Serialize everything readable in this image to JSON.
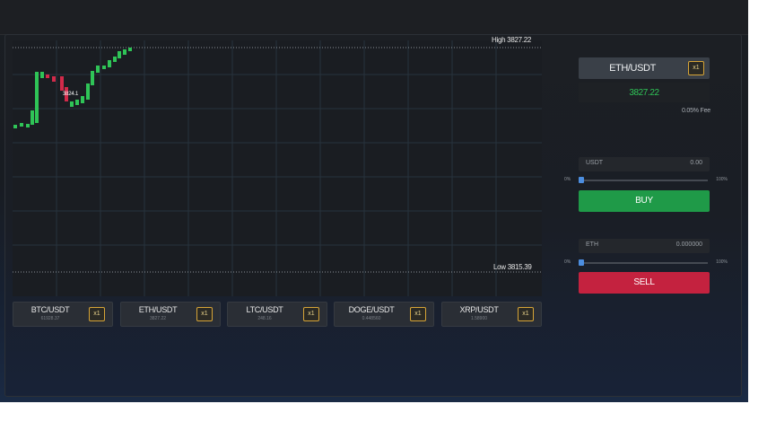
{
  "chart": {
    "high_label": "High 3827.22",
    "low_label": "Low 3815.39",
    "price_tag": "3824.1",
    "colors": {
      "up": "#2fc457",
      "down": "#d22a4a",
      "grid": "#27323d"
    }
  },
  "markets": [
    {
      "pair": "BTC/USDT",
      "price": "61928.37",
      "multiplier": "x1"
    },
    {
      "pair": "ETH/USDT",
      "price": "3827.22",
      "multiplier": "x1"
    },
    {
      "pair": "LTC/USDT",
      "price": "248.16",
      "multiplier": "x1"
    },
    {
      "pair": "DOGE/USDT",
      "price": "0.448560",
      "multiplier": "x1"
    },
    {
      "pair": "XRP/USDT",
      "price": "1.58900",
      "multiplier": "x1"
    }
  ],
  "trade": {
    "pair": "ETH/USDT",
    "multiplier": "x1",
    "price": "3827.22",
    "fee": "0.05% Fee",
    "buy": {
      "currency": "USDT",
      "amount": "0.00",
      "slider_min": "0%",
      "slider_max": "100%",
      "slider_value": 0,
      "button": "BUY"
    },
    "sell": {
      "currency": "ETH",
      "amount": "0.000000",
      "slider_min": "0%",
      "slider_max": "100%",
      "slider_value": 0,
      "button": "SELL"
    }
  }
}
